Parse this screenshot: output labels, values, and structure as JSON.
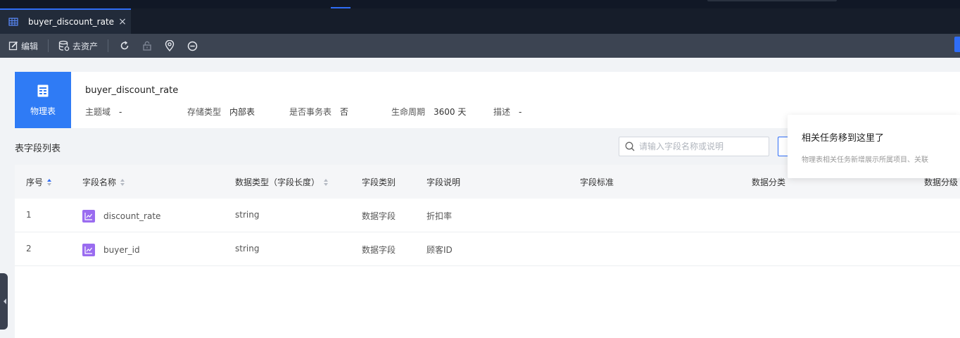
{
  "colors": {
    "accent": "#2f6df6",
    "badge": "#2f7bf5",
    "field_icon": "#9a6cf0",
    "toolbar_bg": "#3c4452",
    "tab_bg": "#222b3a"
  },
  "tab": {
    "title": "buyer_discount_rate",
    "close": "×",
    "icon": "table-grid-icon"
  },
  "toolbar": {
    "edit_label": "编辑",
    "asset_label": "去资产",
    "icons": [
      "refresh-icon",
      "lock-icon",
      "location-pin-icon",
      "minus-circle-icon"
    ]
  },
  "info": {
    "type_label": "物理表",
    "table_name": "buyer_discount_rate",
    "meta": [
      {
        "key": "主题域",
        "value": "-"
      },
      {
        "key": "存储类型",
        "value": "内部表"
      },
      {
        "key": "是否事务表",
        "value": "否"
      },
      {
        "key": "生命周期",
        "value": "3600 天"
      },
      {
        "key": "描述",
        "value": "-"
      }
    ]
  },
  "fields": {
    "section_title": "表字段列表",
    "search_placeholder": "请输入字段名称或说明",
    "columns": [
      "序号",
      "字段名称",
      "数据类型（字段长度）",
      "字段类别",
      "字段说明",
      "字段标准",
      "数据分类",
      "数据分级"
    ],
    "rows": [
      {
        "index": "1",
        "name": "discount_rate",
        "type": "string",
        "category": "数据字段",
        "desc": "折扣率",
        "standard": "",
        "classification": "",
        "level": ""
      },
      {
        "index": "2",
        "name": "buyer_id",
        "type": "string",
        "category": "数据字段",
        "desc": "顾客ID",
        "standard": "",
        "classification": "",
        "level": ""
      }
    ]
  },
  "popover": {
    "title": "相关任务移到这里了",
    "desc": "物理表相关任务新增展示所属项目、关联"
  }
}
